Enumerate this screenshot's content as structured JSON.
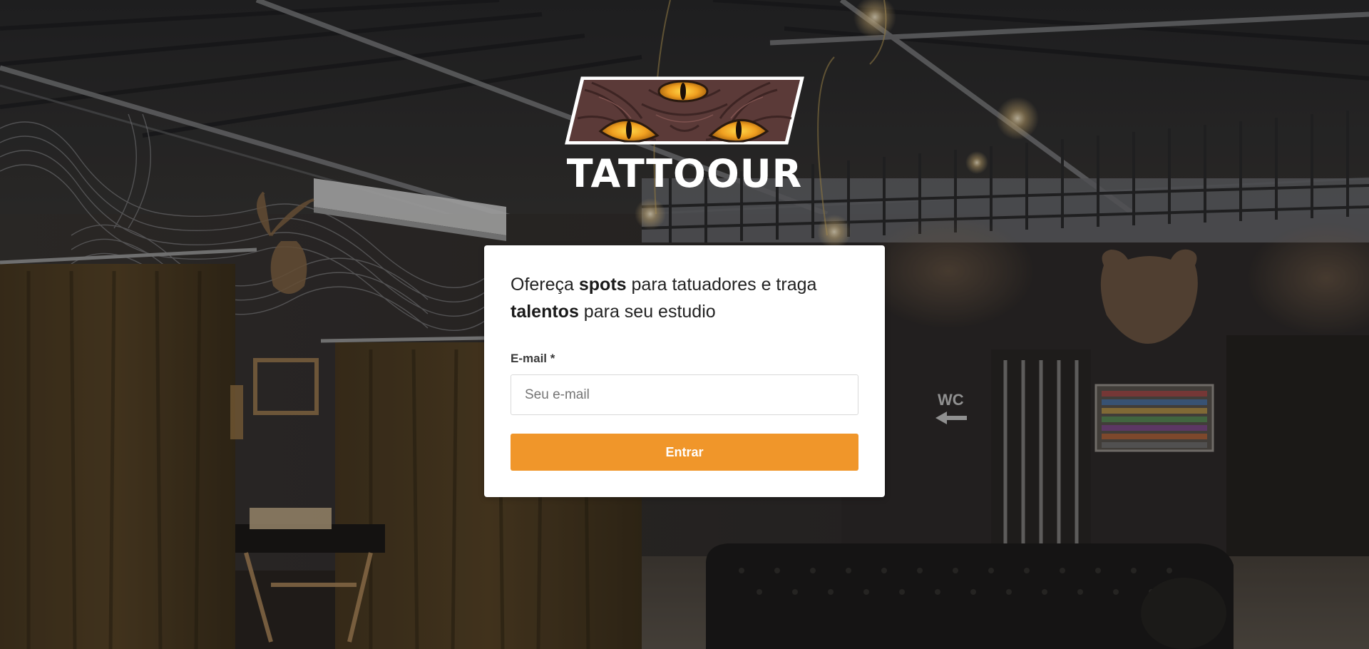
{
  "brand": {
    "name": "TATTOOUR",
    "logo_icon": "three-eyed-creature-icon"
  },
  "background": {
    "wc_sign": "WC"
  },
  "signup": {
    "headline_part1": "Ofereça ",
    "headline_bold1": "spots",
    "headline_part2": " para tatuadores e traga ",
    "headline_bold2": "talentos",
    "headline_part3": " para seu estudio",
    "email_label": "E-mail *",
    "email_value": "",
    "email_placeholder": "Seu e-mail",
    "submit_label": "Entrar"
  },
  "colors": {
    "accent": "#f0962a",
    "card": "#ffffff"
  }
}
